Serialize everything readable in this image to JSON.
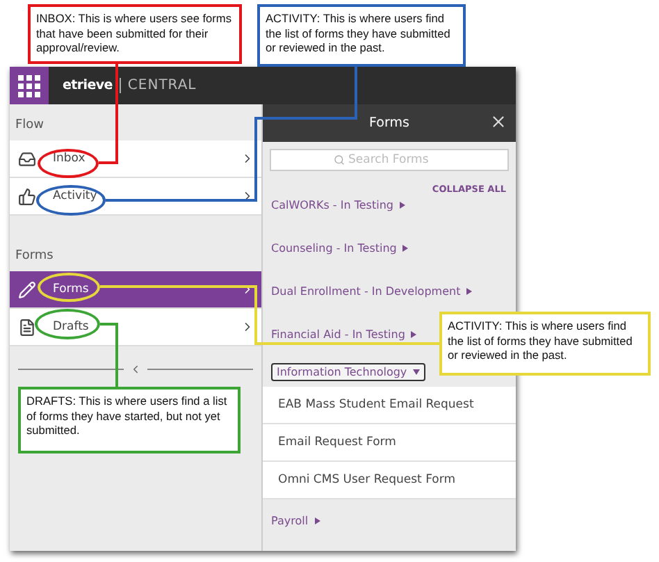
{
  "header": {
    "logo": "etrieve",
    "product": "CENTRAL"
  },
  "sidebar": {
    "sections": [
      {
        "label": "Flow",
        "items": [
          {
            "label": "Inbox",
            "selected": false
          },
          {
            "label": "Activity",
            "selected": false
          }
        ]
      },
      {
        "label": "Forms",
        "items": [
          {
            "label": "Forms",
            "selected": true
          },
          {
            "label": "Drafts",
            "selected": false
          }
        ]
      }
    ]
  },
  "forms_panel": {
    "title": "Forms",
    "search": {
      "placeholder": "Search Forms"
    },
    "collapse_all": "COLLAPSE ALL",
    "categories": [
      {
        "label": "CalWORKs - In Testing",
        "expanded": false
      },
      {
        "label": "Counseling - In Testing",
        "expanded": false
      },
      {
        "label": "Dual Enrollment - In Development",
        "expanded": false
      },
      {
        "label": "Financial Aid - In Testing",
        "expanded": false
      },
      {
        "label": "Information Technology",
        "expanded": true,
        "forms": [
          "EAB Mass Student Email Request",
          "Email Request Form",
          "Omni CMS User Request Form"
        ]
      },
      {
        "label": "Payroll",
        "expanded": false
      }
    ]
  },
  "annotations": [
    {
      "color": "#e3161b",
      "text": "INBOX: This is where users see forms that have been submitted for their approval/review."
    },
    {
      "color": "#2c62b5",
      "text": "ACTIVITY: This is where users find the list of forms they have submitted or reviewed in the past."
    },
    {
      "color": "#e6d83a",
      "text": "ACTIVITY: This is where users find the list of forms they have submitted or reviewed in the past."
    },
    {
      "color": "#3da536",
      "text": "DRAFTS: This is where users find a list of forms they have started, but not yet submitted."
    }
  ]
}
